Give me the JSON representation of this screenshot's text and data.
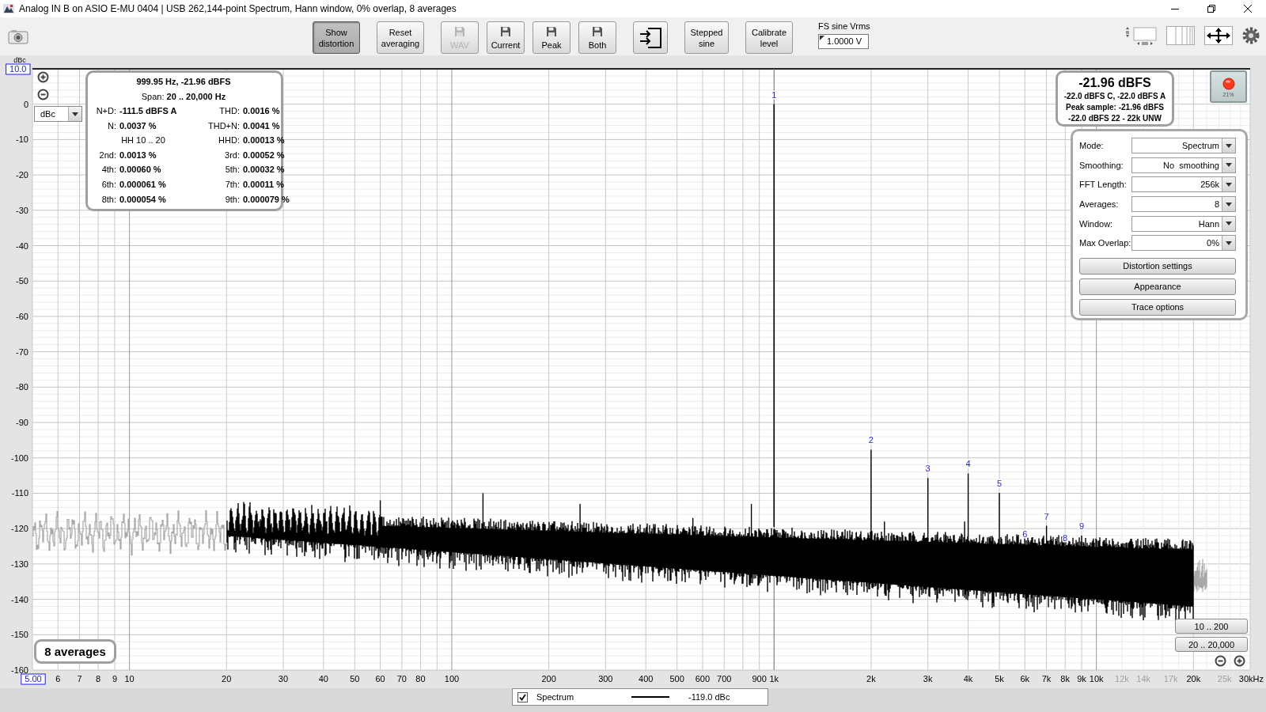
{
  "window": {
    "title": "Analog IN B on ASIO E-MU 0404 | USB 262,144-point Spectrum, Hann window, 0% overlap, 8 averages"
  },
  "toolbar": {
    "groups": [
      [
        {
          "kind": "text",
          "label": "Show distortion",
          "pressed": true,
          "disabled": false
        }
      ],
      [
        {
          "kind": "text",
          "label": "Reset averaging",
          "pressed": false,
          "disabled": false
        }
      ],
      [
        {
          "kind": "save",
          "label": "WAV",
          "pressed": false,
          "disabled": true
        },
        {
          "kind": "save",
          "label": "Current",
          "pressed": false,
          "disabled": false
        },
        {
          "kind": "save",
          "label": "Peak",
          "pressed": false,
          "disabled": false
        },
        {
          "kind": "save",
          "label": "Both",
          "pressed": false,
          "disabled": false
        }
      ],
      [
        {
          "kind": "export",
          "pressed": false,
          "disabled": false
        }
      ],
      [
        {
          "kind": "text",
          "label": "Stepped sine",
          "pressed": false,
          "disabled": false
        }
      ],
      [
        {
          "kind": "text",
          "label": "Calibrate level",
          "pressed": false,
          "disabled": false
        }
      ]
    ],
    "fs_sine": {
      "label": "FS sine Vrms",
      "value": "1.0000 V"
    }
  },
  "plot": {
    "unit_selector": {
      "value": "dBc"
    },
    "y_axis": {
      "unit": "dBc",
      "top_limit": "10.0",
      "labels": [
        "0",
        "-10",
        "-20",
        "-30",
        "-40",
        "-50",
        "-60",
        "-70",
        "-80",
        "-90",
        "-100",
        "-110",
        "-120",
        "-130",
        "-140",
        "-150",
        "-160"
      ]
    },
    "x_axis": {
      "start_limit": "5.00",
      "labels": [
        {
          "text": "6",
          "faint": false
        },
        {
          "text": "7",
          "faint": false
        },
        {
          "text": "8",
          "faint": false
        },
        {
          "text": "9",
          "faint": false
        },
        {
          "text": "10",
          "faint": false
        },
        {
          "text": "20",
          "faint": false
        },
        {
          "text": "30",
          "faint": false
        },
        {
          "text": "40",
          "faint": false
        },
        {
          "text": "50",
          "faint": false
        },
        {
          "text": "60",
          "faint": false
        },
        {
          "text": "70",
          "faint": false
        },
        {
          "text": "80",
          "faint": false
        },
        {
          "text": "100",
          "faint": false
        },
        {
          "text": "200",
          "faint": false
        },
        {
          "text": "300",
          "faint": false
        },
        {
          "text": "400",
          "faint": false
        },
        {
          "text": "500",
          "faint": false
        },
        {
          "text": "600",
          "faint": false
        },
        {
          "text": "700",
          "faint": false
        },
        {
          "text": "900",
          "faint": false
        },
        {
          "text": "1k",
          "faint": false
        },
        {
          "text": "2k",
          "faint": false
        },
        {
          "text": "3k",
          "faint": false
        },
        {
          "text": "4k",
          "faint": false
        },
        {
          "text": "5k",
          "faint": false
        },
        {
          "text": "6k",
          "faint": false
        },
        {
          "text": "7k",
          "faint": false
        },
        {
          "text": "8k",
          "faint": false
        },
        {
          "text": "9k",
          "faint": false
        },
        {
          "text": "10k",
          "faint": false
        },
        {
          "text": "12k",
          "faint": true
        },
        {
          "text": "14k",
          "faint": true
        },
        {
          "text": "17k",
          "faint": true
        },
        {
          "text": "20k",
          "faint": false
        },
        {
          "text": "25k",
          "faint": true
        },
        {
          "text": "30kHz",
          "faint": false
        }
      ]
    },
    "harmonic_markers": [
      "1",
      "2",
      "3",
      "4",
      "5",
      "6",
      "7",
      "8",
      "9"
    ],
    "readout": {
      "title": "999.95 Hz, -21.96 dBFS",
      "span": "Span: **20 .. 20,000 Hz**",
      "items": [
        {
          "label": "N+D:",
          "value": "-111.5 dBFS A"
        },
        {
          "label": "THD:",
          "value": "0.0016 %"
        },
        {
          "label": "N:",
          "value": "0.0037 %"
        },
        {
          "label": "THD+N:",
          "value": "0.0041 %"
        },
        {
          "label": "HH 10 .. 20"
        },
        {
          "label": "HHD:",
          "value": "0.00013 %"
        },
        {
          "label": "2nd:",
          "value": "0.0013 %"
        },
        {
          "label": "3rd:",
          "value": "0.00052 %"
        },
        {
          "label": "4th:",
          "value": "0.00060 %"
        },
        {
          "label": "5th:",
          "value": "0.00032 %"
        },
        {
          "label": "6th:",
          "value": "0.000061 %"
        },
        {
          "label": "7th:",
          "value": "0.00011 %"
        },
        {
          "label": "8th:",
          "value": "0.000054 %"
        },
        {
          "label": "9th:",
          "value": "0.000079 %"
        }
      ]
    },
    "level": {
      "value": "-21.96 dBFS",
      "lines": [
        "-22.0 dBFS C, -22.0 dBFS A",
        "Peak sample: -21.96 dBFS",
        "-22.0 dBFS 22 - 22k UNW"
      ]
    },
    "record": {
      "percent": "21%",
      "recording": true
    },
    "settings": {
      "fields": [
        {
          "label": "Mode:",
          "value": "Spectrum"
        },
        {
          "label": "Smoothing:",
          "value": "No  smoothing"
        },
        {
          "label": "FFT Length:",
          "value": "256k"
        },
        {
          "label": "Averages:",
          "value": "8"
        },
        {
          "label": "Window:",
          "value": "Hann"
        },
        {
          "label": "Max Overlap:",
          "value": "0%"
        }
      ],
      "buttons": [
        "Distortion settings",
        "Appearance",
        "Trace options"
      ]
    },
    "averages_badge": "8 averages",
    "range_buttons": [
      "10 .. 200",
      "20 .. 20,000"
    ]
  },
  "legend": [
    {
      "label": "Spectrum",
      "checked": true,
      "reading": "-119.0 dBc"
    }
  ]
}
